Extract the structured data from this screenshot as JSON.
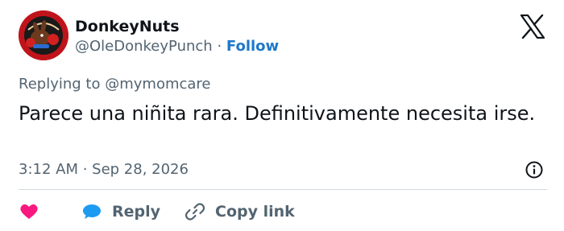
{
  "author": {
    "display_name": "DonkeyNuts",
    "handle": "@OleDonkeyPunch",
    "separator": "·",
    "follow_label": "Follow",
    "avatar_icon": "donkey-boxing-avatar"
  },
  "reply_context": {
    "prefix": "Replying to",
    "mention": "@mymomcare"
  },
  "tweet": {
    "text": "Parece una niñita rara. Definitivamente necesita irse.",
    "timestamp": "3:12 AM · Sep 28, 2026"
  },
  "actions": {
    "like_icon": "heart-icon",
    "reply_label": "Reply",
    "copy_link_label": "Copy link"
  },
  "colors": {
    "follow": "#1d78c9",
    "heart": "#f91880",
    "reply_bubble": "#1d9bf0",
    "muted_text": "#536471",
    "avatar_bg": "#c0141b"
  }
}
